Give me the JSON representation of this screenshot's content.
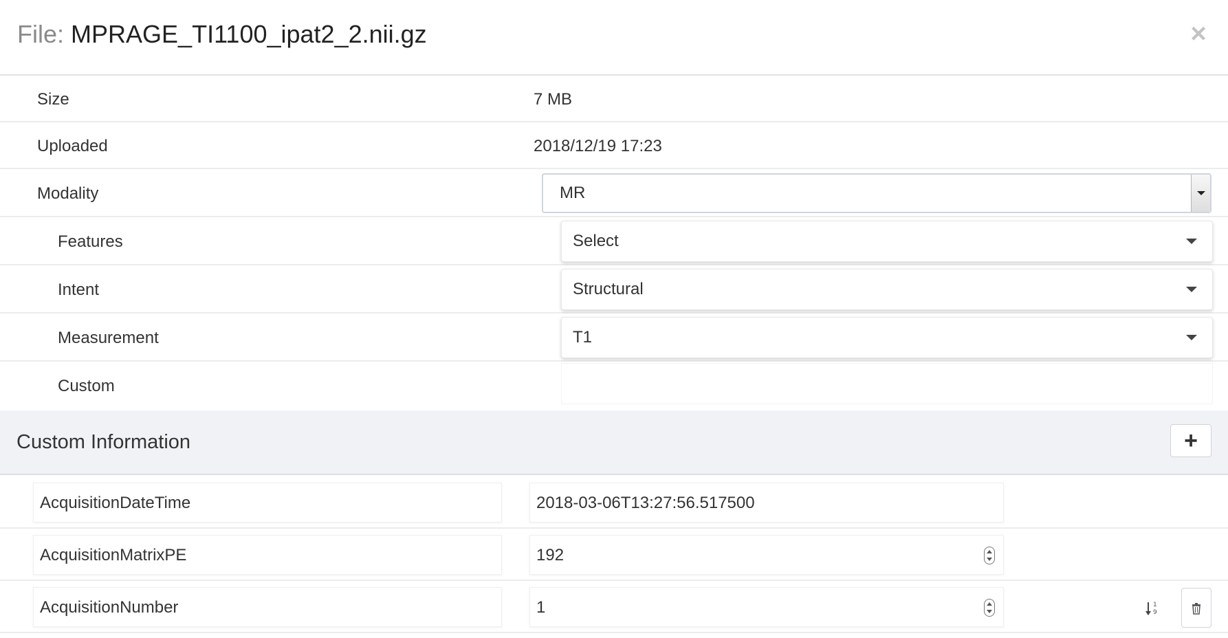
{
  "header": {
    "prefix": "File:",
    "filename": "MPRAGE_TI1100_ipat2_2.nii.gz",
    "close_symbol": "×"
  },
  "info": {
    "size_label": "Size",
    "size_value": "7 MB",
    "uploaded_label": "Uploaded",
    "uploaded_value": "2018/12/19 17:23",
    "modality_label": "Modality",
    "modality_value": "MR",
    "features_label": "Features",
    "features_value": "Select",
    "intent_label": "Intent",
    "intent_value": "Structural",
    "measurement_label": "Measurement",
    "measurement_value": "T1",
    "custom_label": "Custom",
    "custom_value": ""
  },
  "custom_info": {
    "title": "Custom Information",
    "add_symbol": "+",
    "rows": [
      {
        "key": "AcquisitionDateTime",
        "value": "2018-03-06T13:27:56.517500"
      },
      {
        "key": "AcquisitionMatrixPE",
        "value": "192"
      },
      {
        "key": "AcquisitionNumber",
        "value": "1"
      }
    ]
  },
  "icons": {
    "close": "close-icon",
    "add": "plus-icon",
    "sort": "sort-numeric-icon",
    "delete": "trash-icon",
    "stepper": "stepper-icon"
  }
}
